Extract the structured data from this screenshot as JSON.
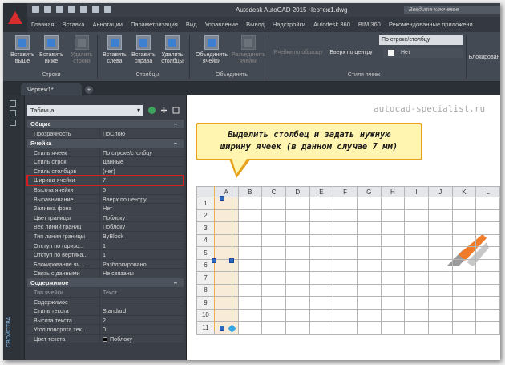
{
  "titlebar": {
    "title": "Autodesk AutoCAD 2015    Чертеж1.dwg",
    "search_placeholder": "Введите ключевое"
  },
  "ribbon_tabs": [
    "Главная",
    "Вставка",
    "Аннотации",
    "Параметризация",
    "Вид",
    "Управление",
    "Вывод",
    "Надстройки",
    "Autodesk 360",
    "BIM 360",
    "Рекомендованные приложени"
  ],
  "ribbon": {
    "rows_group": {
      "label": "Строки",
      "insert_above": "Вставить выше",
      "insert_below": "Вставить ниже",
      "delete_rows": "Удалить строки"
    },
    "cols_group": {
      "label": "Столбцы",
      "insert_left": "Вставить слева",
      "insert_right": "Вставить справа",
      "delete_cols": "Удалить столбцы"
    },
    "merge_group": {
      "label": "Объединить",
      "merge": "Объединить ячейки",
      "unmerge": "Разъединить ячейки"
    },
    "match_cell": "Ячейки по образцу",
    "align": "Вверх по центру",
    "style_group_label": "Стили ячеек",
    "combo_cellstyle": "По строке/столбцу",
    "combo_fill": "Нет",
    "lock": "Блокирован"
  },
  "doc_tab": "Чертеж1*",
  "watermark": "autocad-specialist.ru",
  "palette": {
    "object_type": "Таблица",
    "side_label": "СВОЙСТВА",
    "categories": [
      {
        "name": "Общие",
        "rows": [
          {
            "k": "Прозрачность",
            "v": "ПоСлою"
          }
        ]
      },
      {
        "name": "Ячейка",
        "rows": [
          {
            "k": "Стиль ячеек",
            "v": "По строке/столбцу"
          },
          {
            "k": "Стиль строк",
            "v": "Данные"
          },
          {
            "k": "Стиль столбцов",
            "v": "(нет)"
          },
          {
            "k": "Ширина ячейки",
            "v": "7",
            "highlight": true
          },
          {
            "k": "Высота ячейки",
            "v": "5"
          },
          {
            "k": "Выравнивание",
            "v": "Вверх по центру"
          },
          {
            "k": "Заливка фона",
            "v": "Нет"
          },
          {
            "k": "Цвет границы",
            "v": "Поблоку"
          },
          {
            "k": "Вес линий границ",
            "v": "Поблоку"
          },
          {
            "k": "Тип линии границы",
            "v": "ByBlock"
          },
          {
            "k": "Отступ по горизо...",
            "v": "1"
          },
          {
            "k": "Отступ по вертика...",
            "v": "1"
          },
          {
            "k": "Блокирование яч...",
            "v": "Разблокировано"
          },
          {
            "k": "Связь с данными",
            "v": "Не связаны"
          }
        ]
      },
      {
        "name": "Содержимое",
        "rows": [
          {
            "k": "Тип ячейки",
            "v": "Текст",
            "disabled": true
          },
          {
            "k": "Содержимое",
            "v": ""
          },
          {
            "k": "Стиль текста",
            "v": "Standard"
          },
          {
            "k": "Высота текста",
            "v": "2"
          },
          {
            "k": "Угол поворота тек...",
            "v": "0"
          },
          {
            "k": "Цвет текста",
            "v": "Поблоку",
            "swatch": "#000000"
          }
        ]
      }
    ]
  },
  "callout": {
    "line1": "Выделить столбец и задать нужную",
    "line2": "ширину ячеек (в данном случае 7 мм)"
  },
  "table": {
    "columns": [
      "A",
      "B",
      "C",
      "D",
      "E",
      "F",
      "G",
      "H",
      "I",
      "J",
      "K",
      "L"
    ],
    "rows": [
      "1",
      "2",
      "3",
      "4",
      "5",
      "6",
      "7",
      "8",
      "9",
      "10",
      "11"
    ],
    "selected_column": "A"
  },
  "colors": {
    "accent_red": "#d42020",
    "callout_border": "#e8a21c",
    "callout_fill": "#fff4b0",
    "grip_blue": "#2f66c0"
  }
}
